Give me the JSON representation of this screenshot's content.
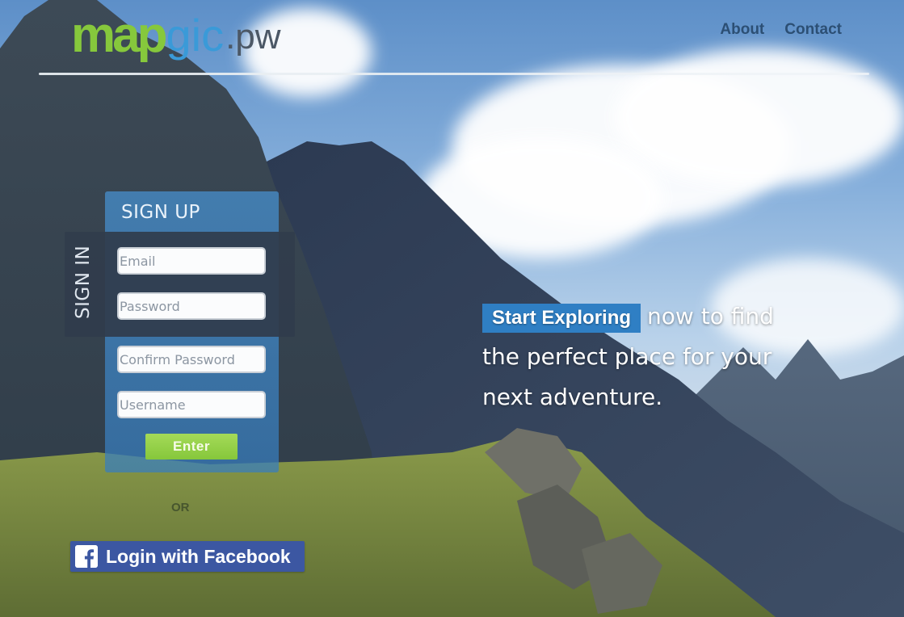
{
  "brand": {
    "logo_part1": "map",
    "logo_part2": "gic",
    "logo_tld": ".pw",
    "color_green": "#86c83c",
    "color_blue": "#3a9ad8"
  },
  "nav": {
    "about": "About",
    "contact": "Contact"
  },
  "signup": {
    "title": "SIGN UP",
    "confirm_password_placeholder": "Confirm Password",
    "username_placeholder": "Username",
    "enter_label": "Enter"
  },
  "signin": {
    "tab_label": "SIGN IN",
    "email_placeholder": "Email",
    "password_placeholder": "Password"
  },
  "divider": {
    "or_label": "OR"
  },
  "facebook": {
    "label": "Login with Facebook",
    "icon": "facebook-icon",
    "color": "#3c57a2"
  },
  "hero": {
    "cta_label": "Start Exploring",
    "tagline": "now to find the perfect place for your next adventure."
  }
}
